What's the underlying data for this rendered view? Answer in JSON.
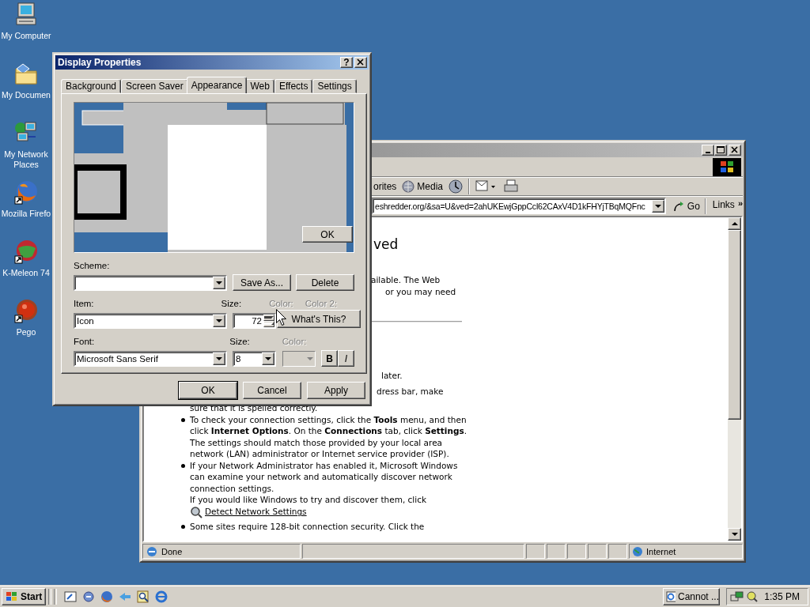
{
  "desktop_icons": [
    {
      "label": "My Computer",
      "kind": "computer"
    },
    {
      "label": "My Documen",
      "kind": "documents"
    },
    {
      "label": "My Network Places",
      "kind": "network"
    },
    {
      "label": "Mozilla Firefo",
      "kind": "firefox"
    },
    {
      "label": "K-Meleon 74",
      "kind": "kmeleon"
    },
    {
      "label": "Pego",
      "kind": "pego"
    }
  ],
  "browser": {
    "toolbar_fragment": "orites",
    "media": "Media",
    "address": "eshredder.org/&sa=U&ved=2ahUKEwjGppCcl62CAxV4D1kFHYjTBqMQFnc",
    "go": "Go",
    "links": "Links",
    "links_more": "»",
    "content": {
      "heading": "ved",
      "lines": [
        "ailable. The Web",
        "or you may need"
      ],
      "fragments": [
        "later.",
        "dress bar, make"
      ],
      "continued_line": "sure that it is spelled correctly.",
      "bullets": [
        {
          "text": "To check your connection settings, click the **Tools** menu, and then click **Internet Options**. On the **Connections** tab, click **Settings**. The settings should match those provided by your local area network (LAN) administrator or Internet service provider (ISP)."
        },
        {
          "text": "If your Network Administrator has enabled it, Microsoft Windows can examine your network and automatically discover network connection settings.",
          "extra": "If you would like Windows to try and discover them, click",
          "link": "Detect Network Settings"
        },
        {
          "text": "Some sites require 128-bit connection security. Click the"
        }
      ]
    },
    "status": "Done",
    "zone": "Internet"
  },
  "dialog": {
    "title": "Display Properties",
    "help": "?",
    "tabs": [
      {
        "label": "Background",
        "selected": false
      },
      {
        "label": "Screen Saver",
        "selected": false
      },
      {
        "label": "Appearance",
        "selected": true
      },
      {
        "label": "Web",
        "selected": false
      },
      {
        "label": "Effects",
        "selected": false
      },
      {
        "label": "Settings",
        "selected": false
      }
    ],
    "preview_button": "OK",
    "scheme": {
      "label": "Scheme:"
    },
    "scheme_buttons": [
      "Save As...",
      "Delete"
    ],
    "item": {
      "label": "Item:",
      "value": "Icon"
    },
    "item_size": {
      "label": "Size:",
      "value": "72"
    },
    "item_colors": [
      {
        "label": "Color:",
        "disabled": true
      },
      {
        "label": "Color 2:",
        "disabled": true
      }
    ],
    "tooltip": "What's This?",
    "font": {
      "label": "Font:",
      "value": "Microsoft Sans Serif"
    },
    "font_size": {
      "label": "Size:",
      "value": "8"
    },
    "font_color": {
      "label": "Color:",
      "disabled": true
    },
    "style_buttons": [
      {
        "label": "B",
        "kind": "bold"
      },
      {
        "label": "I",
        "kind": "italic"
      }
    ],
    "footer_buttons": [
      {
        "label": "OK",
        "default": true
      },
      {
        "label": "Cancel",
        "default": false
      },
      {
        "label": "Apply",
        "default": false
      }
    ]
  },
  "taskbar": {
    "start": "Start",
    "tasks": [
      {
        "label": "Cannot ...",
        "selected": false
      }
    ],
    "clock": "1:35 PM"
  }
}
